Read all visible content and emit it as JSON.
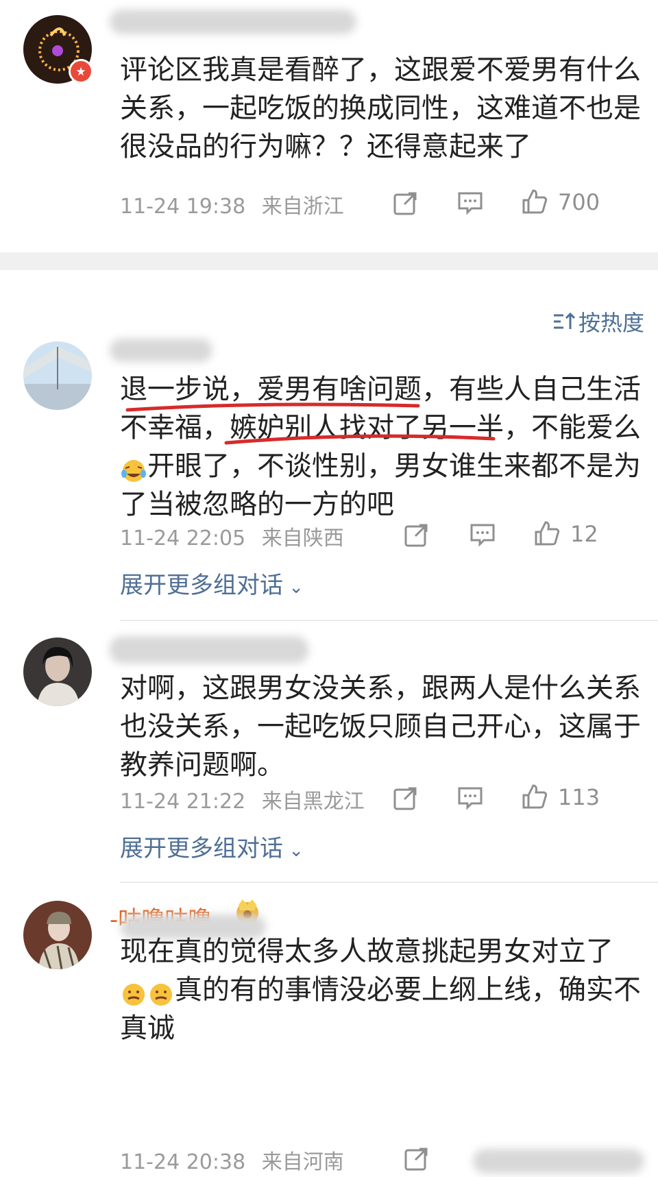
{
  "comments": [
    {
      "text": "评论区我真是看醉了，这跟爱不爱男有什么关系，一起吃饭的换成同性，这难道不也是很没品的行为嘛？？还得意起来了",
      "date": "11-24 19:38",
      "location": "来自浙江",
      "likes": "700"
    },
    {
      "text_a": "退一步说，爱男有啥问题，有些人自己生活不幸福，嫉妒别人找对了另一半，不能爱么",
      "text_b": "开眼了，不谈性别，男女谁生来都不是为了当被忽略的一方的吧",
      "emoji": "crying-laughing-emoji",
      "date": "11-24 22:05",
      "location": "来自陕西",
      "likes": "12",
      "expand": "展开更多组对话"
    },
    {
      "text": "对啊，这跟男女没关系，跟两人是什么关系也没关系，一起吃饭只顾自己开心，这属于教养问题啊。",
      "date": "11-24 21:22",
      "location": "来自黑龙江",
      "likes": "113",
      "expand": "展开更多组对话"
    },
    {
      "text_a": "现在真的觉得太多人故意挑起男女对立了",
      "text_b": "真的有的事情没必要上纲上线，确实不真诚",
      "username_partial": "-咕噜咕噜",
      "date": "11-24 20:38",
      "location": "来自河南"
    }
  ],
  "sort_label": "按热度",
  "colors": {
    "link": "#4f6f95",
    "underline": "#d62b2b",
    "badge": "#e8493a"
  }
}
